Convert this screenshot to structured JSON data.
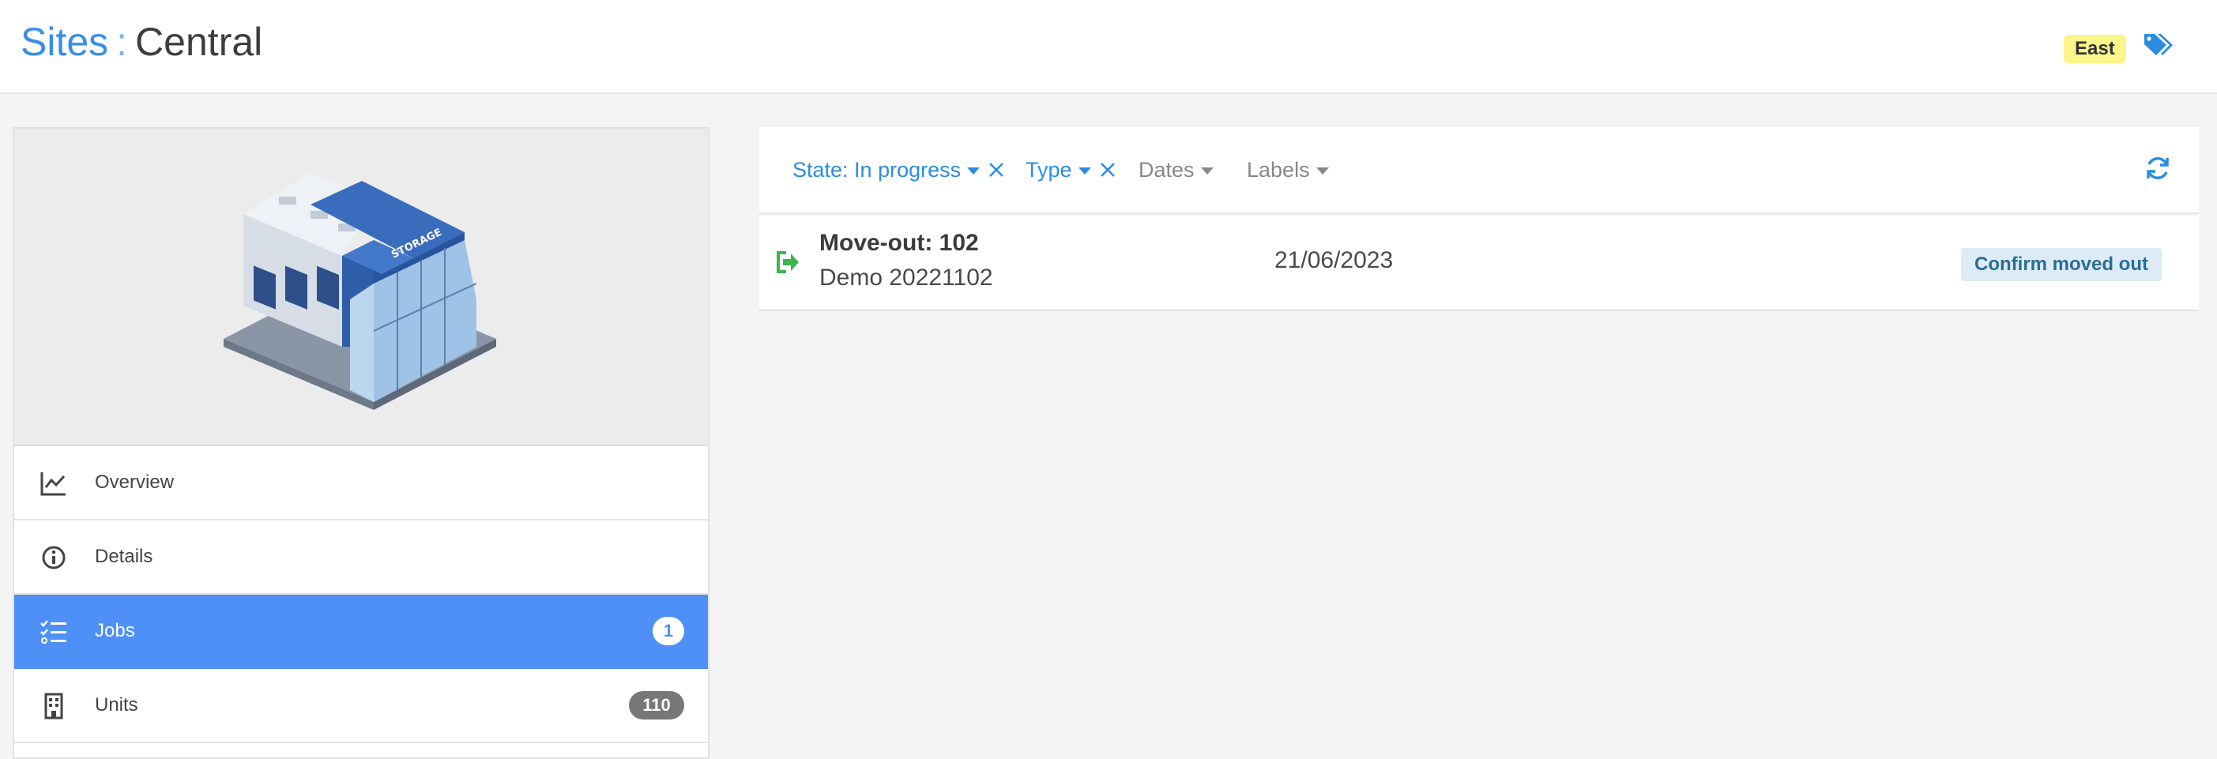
{
  "header": {
    "breadcrumb_root": "Sites",
    "breadcrumb_separator": ":",
    "title": "Central",
    "tag_badge": "East",
    "tags_icon": "tags-icon",
    "colors": {
      "link": "#3a8ee6",
      "badge": "#fbf58a"
    }
  },
  "sidebar": {
    "image_alt": "storage-building-illustration",
    "items": [
      {
        "label": "Overview",
        "icon": "line-chart-icon",
        "active": false
      },
      {
        "label": "Details",
        "icon": "info-circle-icon",
        "active": false
      },
      {
        "label": "Jobs",
        "icon": "checklist-icon",
        "active": true,
        "count": "1"
      },
      {
        "label": "Units",
        "icon": "building-icon",
        "active": false,
        "count": "110"
      }
    ],
    "colors": {
      "active": "#4f90f6"
    }
  },
  "filters": {
    "state": "State: In progress",
    "type": "Type",
    "dates": "Dates",
    "labels": "Labels",
    "refresh_icon": "refresh-icon"
  },
  "jobs": [
    {
      "icon": "move-out-icon",
      "title": "Move-out: 102",
      "subtitle": "Demo 20221102",
      "date": "21/06/2023",
      "action": "Confirm moved out"
    }
  ]
}
